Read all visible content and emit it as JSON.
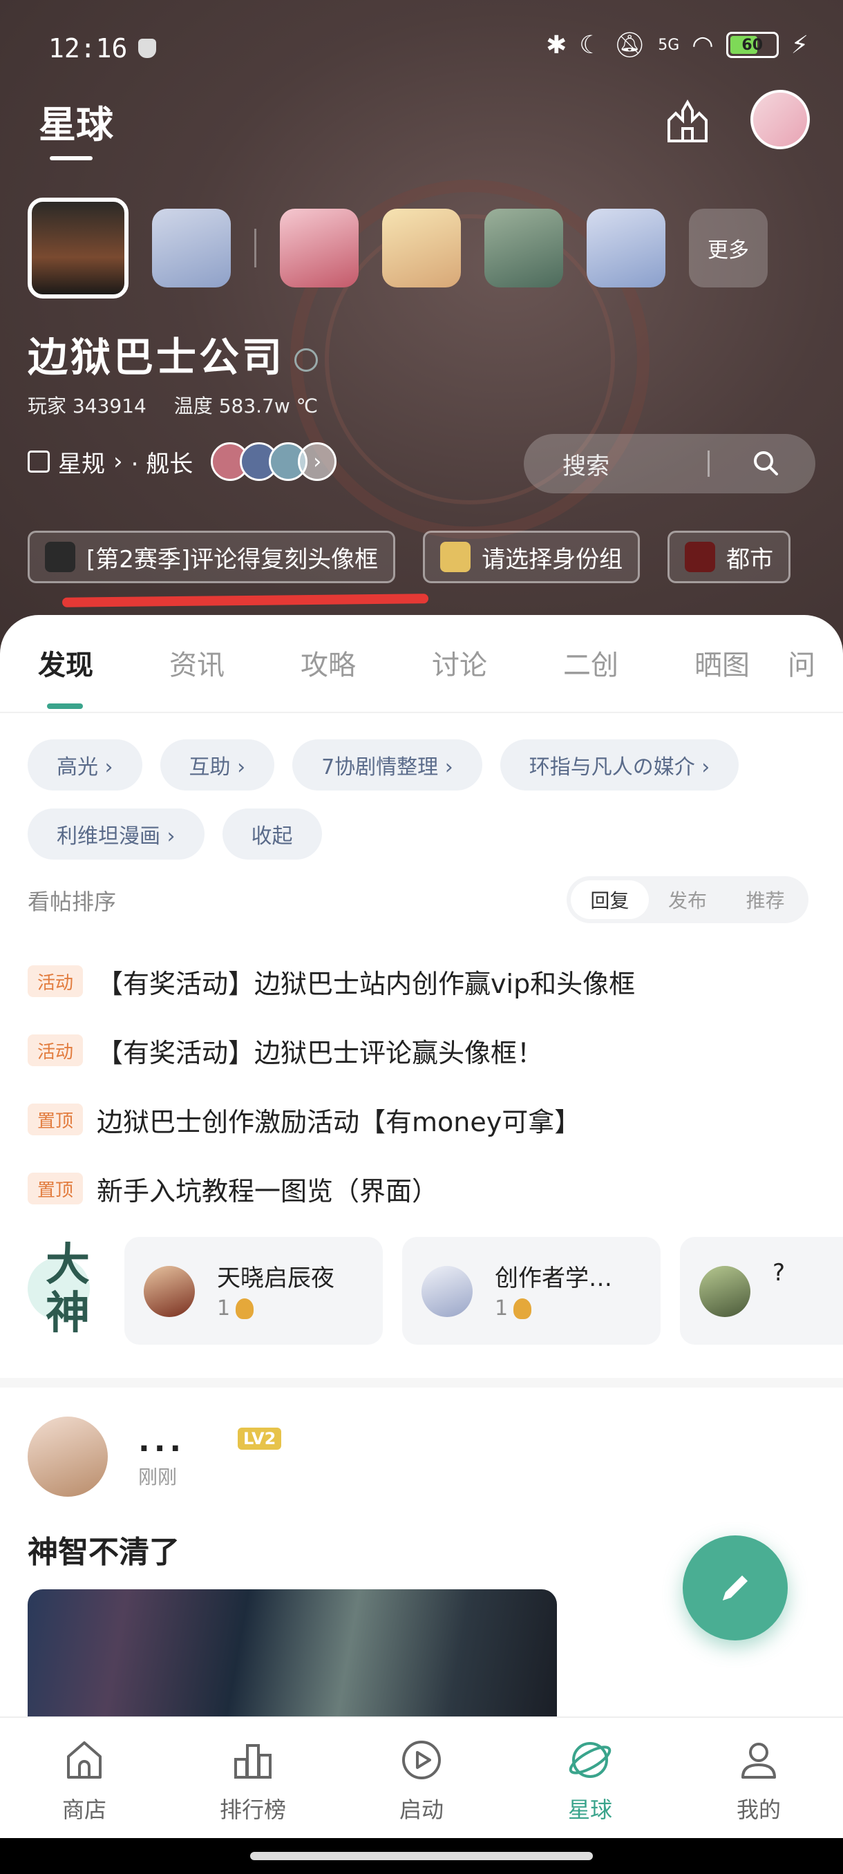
{
  "status_bar": {
    "time": "12:16",
    "battery": "60",
    "signal_label": "5G"
  },
  "header": {
    "title": "星球",
    "game_name": "边狱巴士公司",
    "players_label": "玩家 343914",
    "temperature_label": "温度 583.7w ℃",
    "rules_label": "星规",
    "captain_label": "· 舰长",
    "search_placeholder": "搜索",
    "more_label": "更多"
  },
  "chips": [
    {
      "label": "[第2赛季]评论得复刻头像框"
    },
    {
      "label": "请选择身份组"
    },
    {
      "label": "都市"
    }
  ],
  "tabs": [
    "发现",
    "资讯",
    "攻略",
    "讨论",
    "二创",
    "晒图",
    "问"
  ],
  "tags": [
    "高光 ›",
    "互助 ›",
    "7协剧情整理 ›",
    "环指与凡人の媒介 ›",
    "利维坦漫画 ›",
    "收起"
  ],
  "sort": {
    "label": "看帖排序",
    "options": [
      "回复",
      "发布",
      "推荐"
    ]
  },
  "pinned": [
    {
      "badge": "活动",
      "text": "【有奖活动】边狱巴士站内创作赢vip和头像框"
    },
    {
      "badge": "活动",
      "text": "【有奖活动】边狱巴士评论赢头像框！"
    },
    {
      "badge": "置顶",
      "text": "边狱巴士创作激励活动【有money可拿】"
    },
    {
      "badge": "置顶",
      "text": "新手入坑教程一图览（界面）"
    }
  ],
  "gods": {
    "logo_text": "大神",
    "users": [
      {
        "name": "天晓启辰夜",
        "level": "1"
      },
      {
        "name": "创作者学…",
        "level": "1"
      },
      {
        "name": "?",
        "level": ""
      }
    ]
  },
  "post": {
    "author": "...",
    "level": "LV2",
    "time": "刚刚",
    "title": "神智不清了"
  },
  "bottom_nav": [
    {
      "label": "商店",
      "icon": "shop-icon"
    },
    {
      "label": "排行榜",
      "icon": "ranking-icon"
    },
    {
      "label": "启动",
      "icon": "play-icon"
    },
    {
      "label": "星球",
      "icon": "planet-icon"
    },
    {
      "label": "我的",
      "icon": "user-icon"
    }
  ],
  "colors": {
    "accent": "#3aa48c",
    "badge_bg": "#fdebe0",
    "badge_text": "#e27c3e",
    "annotation_red": "#e53935"
  }
}
